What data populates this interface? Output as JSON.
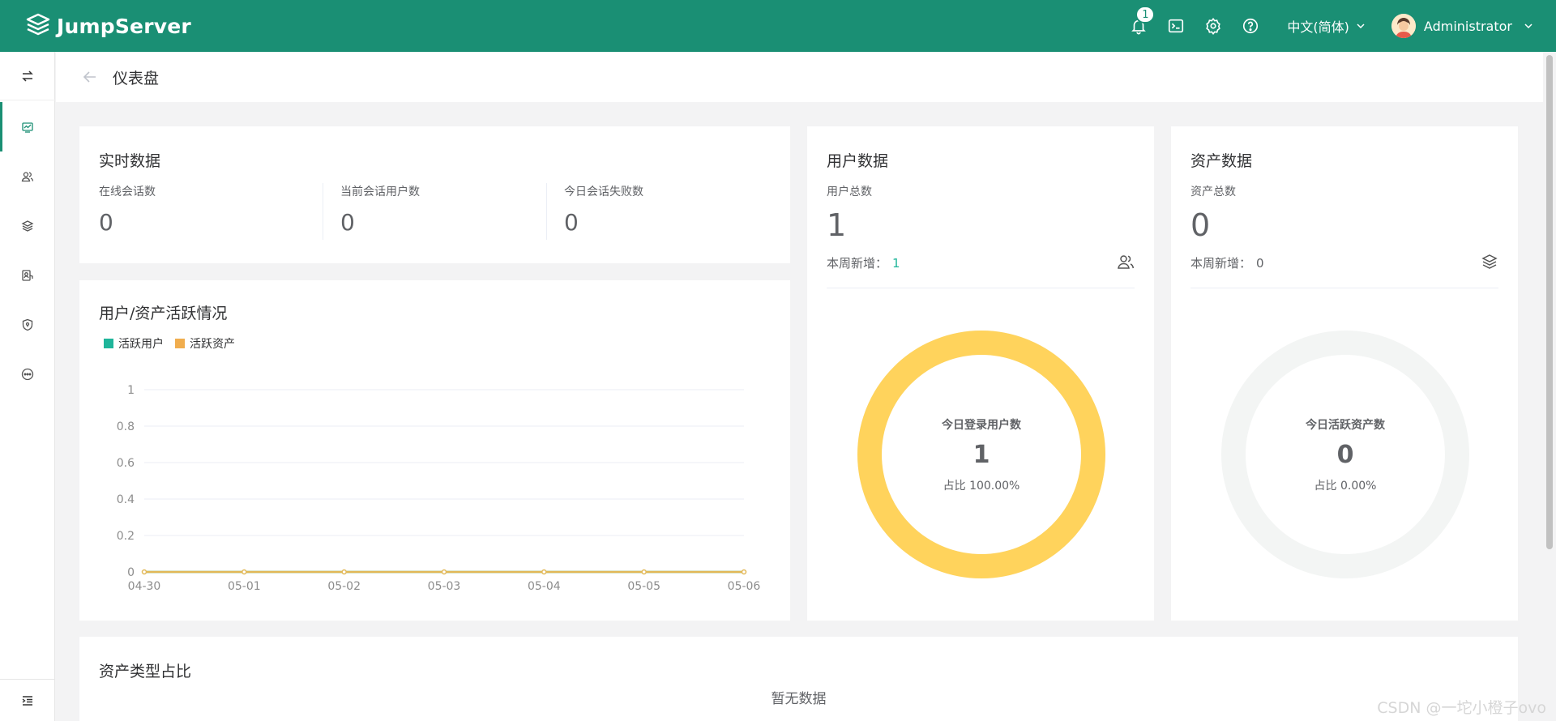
{
  "app": {
    "name": "JumpServer",
    "brand_color": "#1a8f74"
  },
  "topbar": {
    "notification_count": "1",
    "language": "中文(简体)",
    "user_name": "Administrator",
    "icons": [
      "bell-icon",
      "terminal-icon",
      "gear-icon",
      "help-icon"
    ]
  },
  "sidebar": {
    "items": [
      "toggle-icon",
      "dashboard-icon",
      "users-icon",
      "assets-icon",
      "perms-icon",
      "audit-icon",
      "more-icon"
    ],
    "active": "dashboard-icon"
  },
  "page": {
    "title": "仪表盘"
  },
  "realtime": {
    "title": "实时数据",
    "metrics": [
      {
        "label": "在线会话数",
        "value": "0"
      },
      {
        "label": "当前会话用户数",
        "value": "0"
      },
      {
        "label": "今日会话失败数",
        "value": "0"
      }
    ]
  },
  "users": {
    "title": "用户数据",
    "total_label": "用户总数",
    "total_value": "1",
    "week_label": "本周新增：",
    "week_value": "1",
    "donut": {
      "label": "今日登录用户数",
      "value": "1",
      "pct": "占比 100.00%",
      "fraction": 1.0,
      "color": "#ffd35c"
    }
  },
  "assets": {
    "title": "资产数据",
    "total_label": "资产总数",
    "total_value": "0",
    "week_label": "本周新增：",
    "week_value": "0",
    "donut": {
      "label": "今日活跃资产数",
      "value": "0",
      "pct": "占比 0.00%",
      "fraction": 0.0,
      "color": "#f3f5f4"
    }
  },
  "activity": {
    "title": "用户/资产活跃情况",
    "legend": [
      {
        "name": "活跃用户",
        "color": "#1fb59a"
      },
      {
        "name": "活跃资产",
        "color": "#f0ad4e"
      }
    ]
  },
  "chart_data": {
    "type": "line",
    "title": "用户/资产活跃情况",
    "x": [
      "04-30",
      "05-01",
      "05-02",
      "05-03",
      "05-04",
      "05-05",
      "05-06"
    ],
    "yticks": [
      "0",
      "0.2",
      "0.4",
      "0.6",
      "0.8",
      "1"
    ],
    "ylim": [
      0,
      1
    ],
    "series": [
      {
        "name": "活跃用户",
        "values": [
          0,
          0,
          0,
          0,
          0,
          0,
          0
        ],
        "color": "#1fb59a"
      },
      {
        "name": "活跃资产",
        "values": [
          0,
          0,
          0,
          0,
          0,
          0,
          0
        ],
        "color": "#e2b857"
      }
    ],
    "grid": true,
    "legend": "top-left"
  },
  "asset_types": {
    "title": "资产类型占比",
    "empty_text": "暂无数据"
  },
  "watermark": "CSDN @一坨小橙子ovo"
}
